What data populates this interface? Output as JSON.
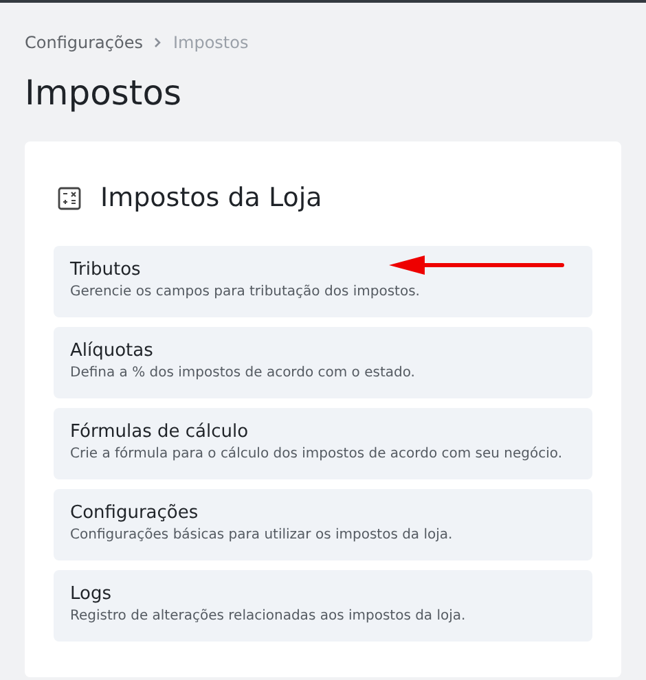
{
  "breadcrumb": [
    {
      "label": "Configurações",
      "current": false
    },
    {
      "label": "Impostos",
      "current": true
    }
  ],
  "page_title": "Impostos",
  "card": {
    "title": "Impostos da Loja",
    "items": [
      {
        "title": "Tributos",
        "description": "Gerencie os campos para tributação dos impostos.",
        "pointer_arrow": true
      },
      {
        "title": "Alíquotas",
        "description": "Defina a % dos impostos de acordo com o estado.",
        "pointer_arrow": false
      },
      {
        "title": "Fórmulas de cálculo",
        "description": "Crie a fórmula para o cálculo dos impostos de acordo com seu negócio.",
        "pointer_arrow": false
      },
      {
        "title": "Configurações",
        "description": "Configurações básicas para utilizar os impostos da loja.",
        "pointer_arrow": false
      },
      {
        "title": "Logs",
        "description": "Registro de alterações relacionadas aos impostos da loja.",
        "pointer_arrow": false
      }
    ]
  }
}
